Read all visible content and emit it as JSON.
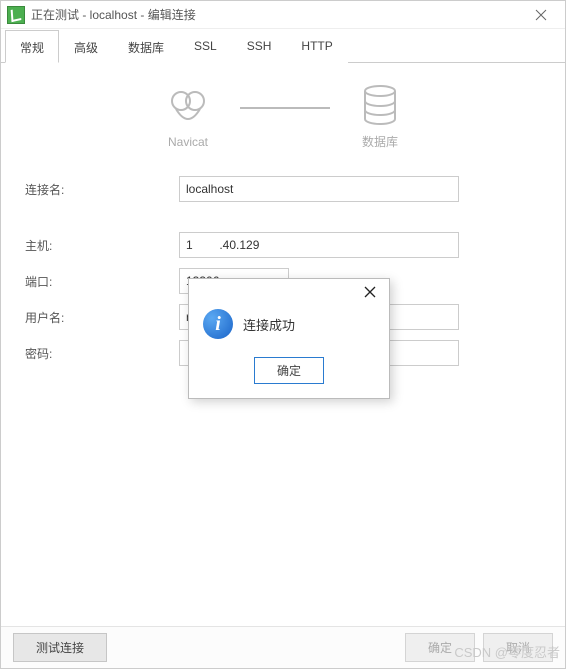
{
  "titlebar": {
    "title": "正在测试 - localhost - 编辑连接"
  },
  "tabs": [
    "常规",
    "高级",
    "数据库",
    "SSL",
    "SSH",
    "HTTP"
  ],
  "active_tab": 0,
  "diagram": {
    "left_label": "Navicat",
    "right_label": "数据库"
  },
  "form": {
    "connection_name": {
      "label": "连接名:",
      "value": "localhost"
    },
    "host": {
      "label": "主机:",
      "value": "1        .40.129"
    },
    "port": {
      "label": "端口:",
      "value": "13306"
    },
    "username": {
      "label": "用户名:",
      "value": "root"
    },
    "password": {
      "label": "密码:",
      "value": ""
    }
  },
  "modal": {
    "message": "连接成功",
    "ok": "确定"
  },
  "footer": {
    "test": "测试连接",
    "ok": "确定",
    "cancel": "取消"
  },
  "watermark": "CSDN @零度忍者"
}
